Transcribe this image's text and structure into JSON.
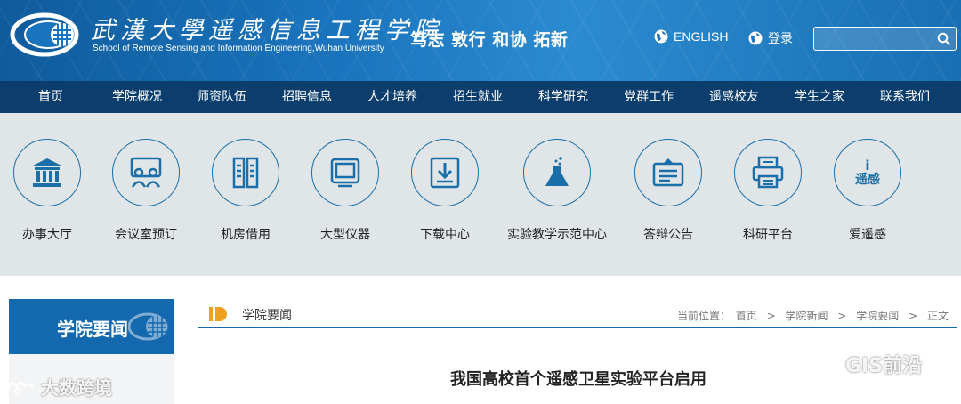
{
  "header": {
    "school_name_cn": "武漢大學遥感信息工程学院",
    "school_name_en": "School of Remote Sensing and Information Engineering,Wuhan University",
    "motto": "笃志 敦行 和协 拓新",
    "english_link": "ENGLISH",
    "login_link": "登录",
    "search": {
      "value": "",
      "placeholder": ""
    }
  },
  "nav": {
    "items": [
      "首页",
      "学院概况",
      "师资队伍",
      "招聘信息",
      "人才培养",
      "招生就业",
      "科学研究",
      "党群工作",
      "遥感校友",
      "学生之家",
      "联系我们"
    ]
  },
  "quick_links": {
    "items": [
      {
        "label": "办事大厅",
        "icon": "building-icon"
      },
      {
        "label": "会议室预订",
        "icon": "meeting-icon"
      },
      {
        "label": "机房借用",
        "icon": "server-icon"
      },
      {
        "label": "大型仪器",
        "icon": "monitor-icon"
      },
      {
        "label": "下载中心",
        "icon": "download-icon"
      },
      {
        "label": "实验教学示范中心",
        "icon": "flask-icon"
      },
      {
        "label": "答辩公告",
        "icon": "notice-icon"
      },
      {
        "label": "科研平台",
        "icon": "printer-icon"
      },
      {
        "label": "爱遥感",
        "icon": "info-icon",
        "icon_text": "i\n遥感"
      }
    ]
  },
  "sidebar": {
    "title": "学院要闻"
  },
  "content": {
    "section_title": "学院要闻",
    "breadcrumb": {
      "prefix": "当前位置：",
      "items": [
        "首页",
        "学院新闻",
        "学院要闻",
        "正文"
      ]
    },
    "article_title": "我国高校首个遥感卫星实验平台启用"
  },
  "watermarks": {
    "left": "大数跨境",
    "right": "GIS前沿"
  },
  "colors": {
    "header_blue": "#1a74bd",
    "nav_dark_blue": "#0c3e6d",
    "accent_blue": "#1468ad",
    "quick_bg": "#e0e5e8",
    "marker_orange": "#f0a020"
  }
}
